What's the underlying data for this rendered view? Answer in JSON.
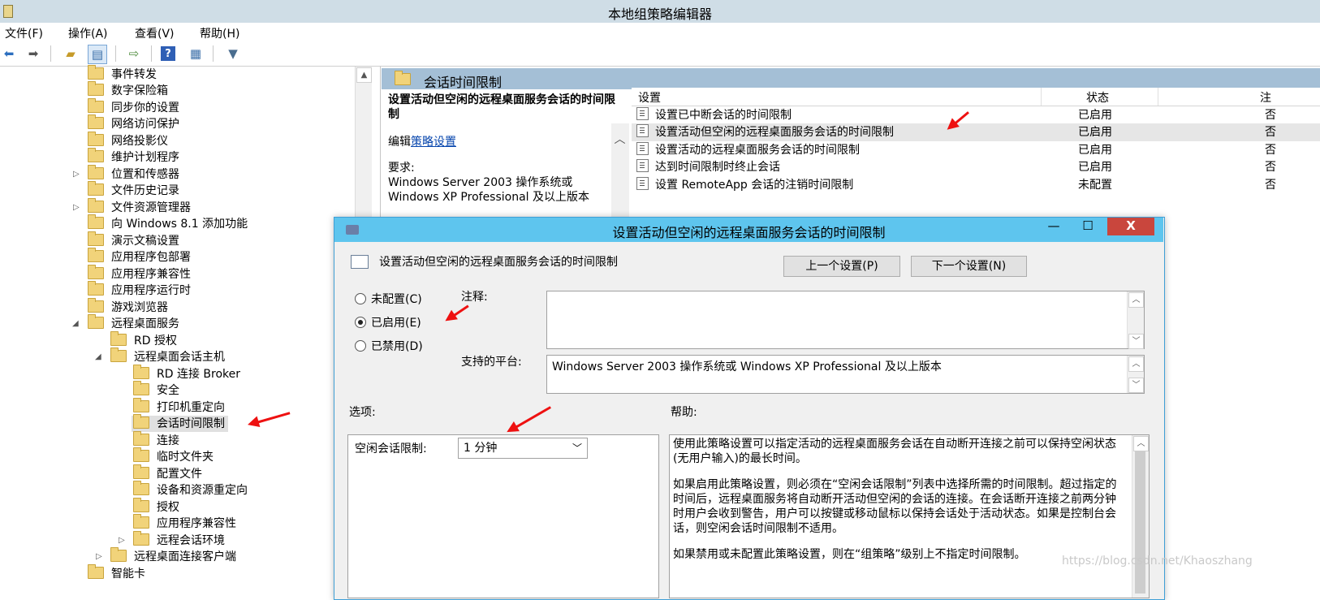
{
  "window": {
    "title": "本地组策略编辑器"
  },
  "menu": [
    "文件(F)",
    "操作(A)",
    "查看(V)",
    "帮助(H)"
  ],
  "toolbar": {
    "icons": [
      "back-arrow-icon",
      "forward-arrow-icon",
      "folder-up-icon",
      "show-hide-tree-icon",
      "export-list-icon",
      "help-icon",
      "properties-icon",
      "filter-icon"
    ]
  },
  "tree": {
    "items": [
      {
        "label": "事件转发"
      },
      {
        "label": "数字保险箱"
      },
      {
        "label": "同步你的设置"
      },
      {
        "label": "网络访问保护"
      },
      {
        "label": "网络投影仪"
      },
      {
        "label": "维护计划程序"
      },
      {
        "label": "位置和传感器"
      },
      {
        "label": "文件历史记录"
      },
      {
        "label": "文件资源管理器"
      },
      {
        "label": "向 Windows 8.1 添加功能"
      },
      {
        "label": "演示文稿设置"
      },
      {
        "label": "应用程序包部署"
      },
      {
        "label": "应用程序兼容性"
      },
      {
        "label": "应用程序运行时"
      },
      {
        "label": "游戏浏览器"
      },
      {
        "label": "远程桌面服务"
      },
      {
        "label": "RD 授权"
      },
      {
        "label": "远程桌面会话主机"
      },
      {
        "label": "RD 连接 Broker"
      },
      {
        "label": "安全"
      },
      {
        "label": "打印机重定向"
      },
      {
        "label": "会话时间限制"
      },
      {
        "label": "连接"
      },
      {
        "label": "临时文件夹"
      },
      {
        "label": "配置文件"
      },
      {
        "label": "设备和资源重定向"
      },
      {
        "label": "授权"
      },
      {
        "label": "应用程序兼容性"
      },
      {
        "label": "远程会话环境"
      },
      {
        "label": "远程桌面连接客户端"
      },
      {
        "label": "智能卡"
      }
    ]
  },
  "right": {
    "header": "会话时间限制",
    "desc_title": "设置活动但空闲的远程桌面服务会话的时间限制",
    "edit_prefix": "编辑",
    "edit_link": "策略设置",
    "req_label": "要求:",
    "req_text": "Windows Server 2003 操作系统或 Windows XP Professional 及以上版本",
    "columns": {
      "setting": "设置",
      "state": "状态",
      "note": "注"
    },
    "rows": [
      {
        "name": "设置已中断会话的时间限制",
        "state": "已启用",
        "note": "否"
      },
      {
        "name": "设置活动但空闲的远程桌面服务会话的时间限制",
        "state": "已启用",
        "note": "否"
      },
      {
        "name": "设置活动的远程桌面服务会话的时间限制",
        "state": "已启用",
        "note": "否"
      },
      {
        "name": "达到时间限制时终止会话",
        "state": "已启用",
        "note": "否"
      },
      {
        "name": "设置 RemoteApp 会话的注销时间限制",
        "state": "未配置",
        "note": "否"
      }
    ]
  },
  "dialog": {
    "title": "设置活动但空闲的远程桌面服务会话的时间限制",
    "subtitle": "设置活动但空闲的远程桌面服务会话的时间限制",
    "window_buttons": {
      "minimize": "—",
      "maximize": "☐",
      "close": "X"
    },
    "prev_button": "上一个设置(P)",
    "next_button": "下一个设置(N)",
    "radios": [
      {
        "label": "未配置(C)",
        "checked": false
      },
      {
        "label": "已启用(E)",
        "checked": true
      },
      {
        "label": "已禁用(D)",
        "checked": false
      }
    ],
    "comment_label": "注释:",
    "platform_label": "支持的平台:",
    "platform_text": "Windows Server 2003 操作系统或 Windows XP Professional 及以上版本",
    "options_label": "选项:",
    "help_label": "帮助:",
    "idle_label": "空闲会话限制:",
    "idle_value": "1 分钟",
    "help_paragraphs": [
      "使用此策略设置可以指定活动的远程桌面服务会话在自动断开连接之前可以保持空闲状态(无用户输入)的最长时间。",
      "如果启用此策略设置，则必须在“空闲会话限制”列表中选择所需的时间限制。超过指定的时间后，远程桌面服务将自动断开活动但空闲的会话的连接。在会话断开连接之前两分钟时用户会收到警告，用户可以按键或移动鼠标以保持会话处于活动状态。如果是控制台会话，则空闲会话时间限制不适用。",
      "如果禁用或未配置此策略设置，则在“组策略”级别上不指定时间限制。"
    ]
  },
  "watermark": "https://blog.csdn.net/Khaoszhang",
  "colors": {
    "accent": "#5ec5ee",
    "header": "#a4bfd6",
    "arrow": "#e11111"
  }
}
